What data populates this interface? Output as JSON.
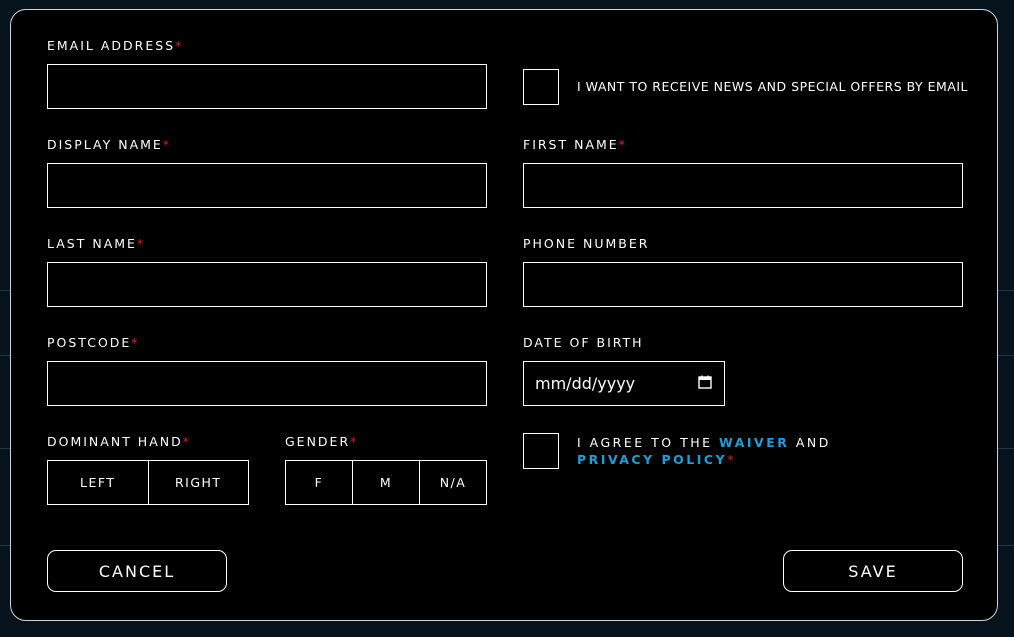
{
  "form": {
    "email": {
      "label": "EMAIL ADDRESS",
      "required": "*",
      "value": ""
    },
    "newsletter": {
      "label": "I WANT TO RECEIVE NEWS AND SPECIAL OFFERS BY EMAIL"
    },
    "display_name": {
      "label": "DISPLAY NAME",
      "required": "*",
      "value": ""
    },
    "first_name": {
      "label": "FIRST NAME",
      "required": "*",
      "value": ""
    },
    "last_name": {
      "label": "LAST NAME",
      "required": "*",
      "value": ""
    },
    "phone": {
      "label": "PHONE NUMBER",
      "value": ""
    },
    "postcode": {
      "label": "POSTCODE",
      "required": "*",
      "value": ""
    },
    "dob": {
      "label": "DATE OF BIRTH",
      "placeholder": "mm/dd/yyyy",
      "icon": "calendar-icon"
    },
    "hand": {
      "label": "DOMINANT HAND",
      "required": "*",
      "options": [
        "LEFT",
        "RIGHT"
      ]
    },
    "gender": {
      "label": "GENDER",
      "required": "*",
      "options": [
        "F",
        "M",
        "N/A"
      ]
    },
    "agree": {
      "prefix": "I AGREE TO THE",
      "waiver": "WAIVER",
      "and": "AND",
      "privacy": "PRIVACY POLICY",
      "required": "*"
    }
  },
  "actions": {
    "cancel": "CANCEL",
    "save": "SAVE"
  },
  "colors": {
    "required": "#e01b24",
    "link": "#1c9fd8",
    "panel": "#000000",
    "border": "#ffffff"
  }
}
